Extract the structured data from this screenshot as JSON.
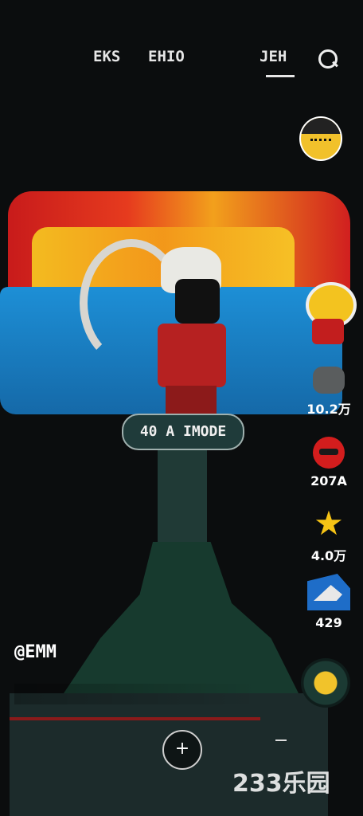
{
  "status_bar": {
    "time": "",
    "indicators": ""
  },
  "tabs": [
    {
      "label": ""
    },
    {
      "label": "EKS"
    },
    {
      "label": "EHIO"
    },
    {
      "label": ""
    },
    {
      "label": "JEH"
    }
  ],
  "active_tab_index": 4,
  "icons": {
    "search": "search-icon",
    "plus": "plus-icon",
    "star": "star-icon",
    "share": "share-icon",
    "comment": "comment-icon",
    "like": "like-icon"
  },
  "rail": {
    "tag_text": "",
    "like_count": "10.2万",
    "comment_count": "207A",
    "favorite_count": "4.0万",
    "share_count": "429"
  },
  "sign": {
    "text": "40 A IMODE"
  },
  "author": {
    "handle": "@EMM"
  },
  "caption": {
    "text": ""
  },
  "bottom_nav": {
    "home": "",
    "friends": "",
    "messages": "",
    "me": ""
  },
  "watermark": "233乐园",
  "colors": {
    "accent_red": "#d31d1d",
    "star_yellow": "#f6c315",
    "share_blue": "#1e6dc8",
    "background": "#0b0d0e"
  }
}
